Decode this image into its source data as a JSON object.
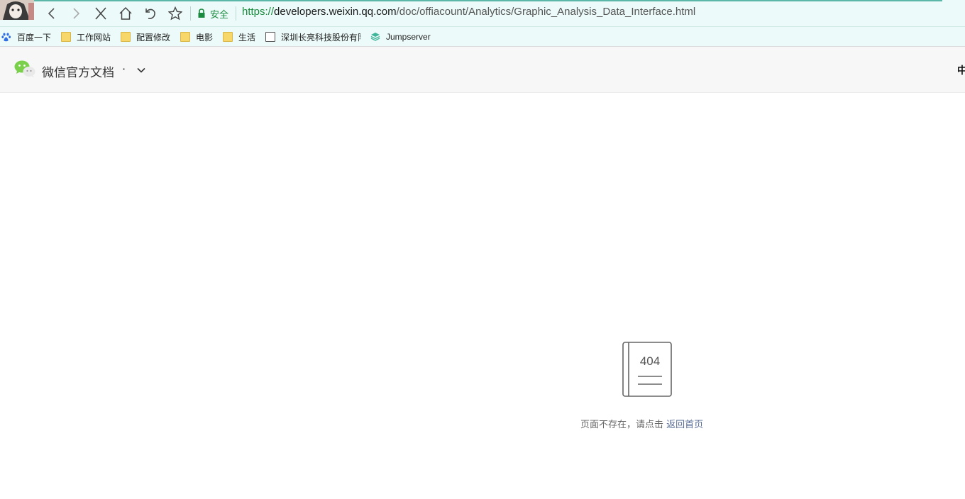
{
  "browser": {
    "security_label": "安全",
    "url": {
      "protocol": "https://",
      "host": "developers.weixin.qq.com",
      "path": "/doc/offiacount/Analytics/Graphic_Analysis_Data_Interface.html"
    },
    "icons": [
      "back-icon",
      "forward-icon",
      "stop-icon",
      "home-icon",
      "undo-icon",
      "star-icon",
      "lock-icon"
    ],
    "bookmarks": [
      {
        "label": "百度一下",
        "icon": "baidu-paw-icon"
      },
      {
        "label": "工作网站",
        "icon": "folder-icon"
      },
      {
        "label": "配置修改",
        "icon": "folder-icon"
      },
      {
        "label": "电影",
        "icon": "folder-icon"
      },
      {
        "label": "生活",
        "icon": "folder-icon"
      },
      {
        "label": "深圳长亮科技股份有限",
        "icon": "page-icon"
      },
      {
        "label": "Jumpserver",
        "icon": "jumpserver-icon"
      }
    ]
  },
  "header": {
    "title": "微信官方文档",
    "separator": "·",
    "lang": "中"
  },
  "error": {
    "code": "404",
    "message": "页面不存在，请点击",
    "link_label": "返回首页"
  },
  "colors": {
    "chrome_bg": "#ecfaf9",
    "secure_green": "#1a8a3e",
    "link_blue": "#576b95",
    "wechat_green": "#7bd04b"
  }
}
